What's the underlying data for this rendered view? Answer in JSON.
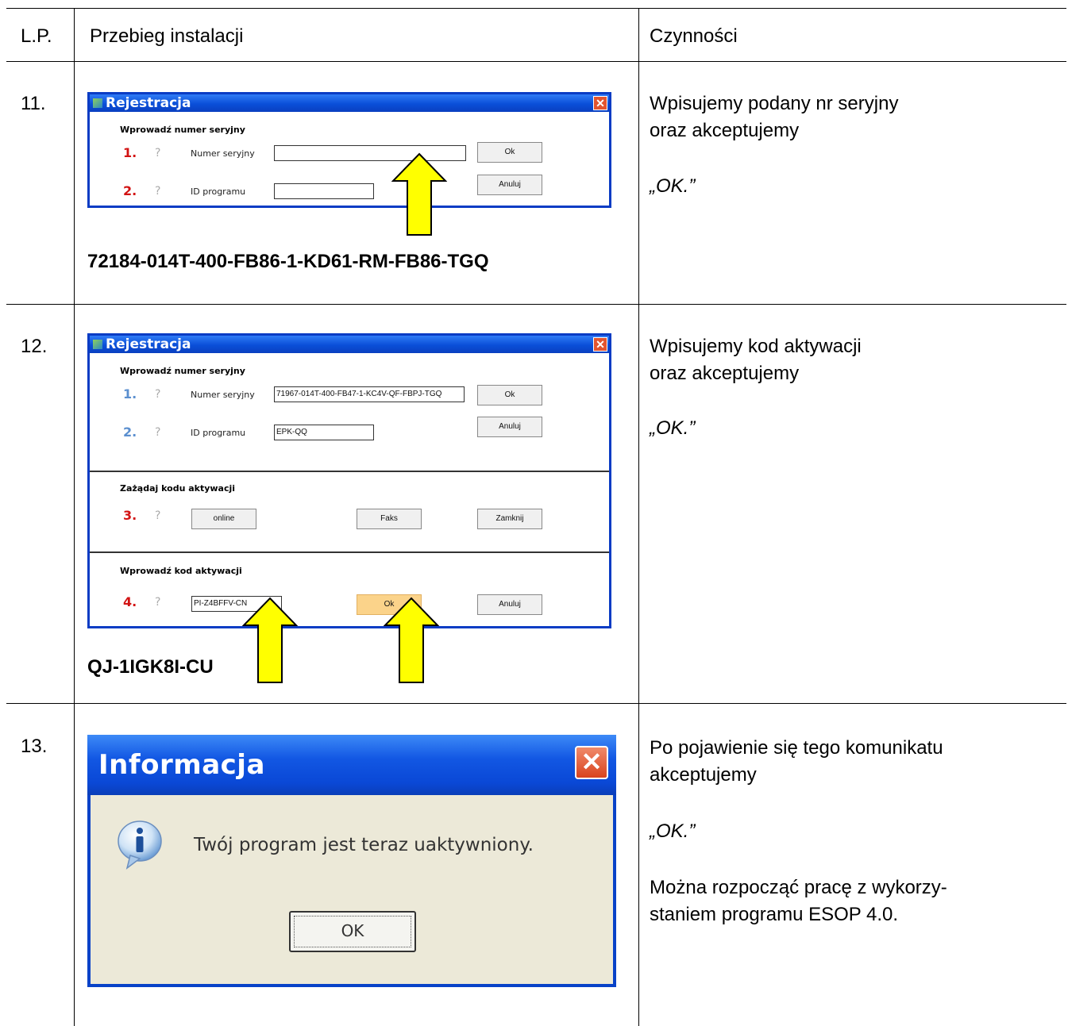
{
  "header": {
    "col_lp": "L.P.",
    "col_przebieg": "Przebieg instalacji",
    "col_czynnosci": "Czynności"
  },
  "rows": [
    {
      "lp": "11.",
      "serial_code": "72184-014T-400-FB86-1-KD61-RM-FB86-TGQ",
      "action_lines": [
        "Wpisujemy podany nr seryjny",
        "oraz akceptujemy"
      ],
      "action_ok": "„OK.”",
      "dialog": {
        "title": "Rejestracja",
        "section": "Wprowadź numer seryjny",
        "step1": "1.",
        "step2": "2.",
        "q": "?",
        "serial_label": "Numer seryjny",
        "id_label": "ID programu",
        "serial_value": "",
        "id_value": "",
        "ok": "Ok",
        "cancel": "Anuluj"
      }
    },
    {
      "lp": "12.",
      "activation_code": "QJ-1IGK8I-CU",
      "action_lines": [
        "Wpisujemy kod aktywacji",
        "oraz akceptujemy"
      ],
      "action_ok": "„OK.”",
      "dialog": {
        "title": "Rejestracja",
        "section1": "Wprowadź numer seryjny",
        "section2": "Zażądaj kodu aktywacji",
        "section3": "Wprowadź kod aktywacji",
        "step1": "1.",
        "step2": "2.",
        "step3": "3.",
        "step4": "4.",
        "q": "?",
        "serial_label": "Numer seryjny",
        "id_label": "ID programu",
        "serial_value": "71967-014T-400-FB47-1-KC4V-QF-FBPJ-TGQ",
        "id_value": "EPK-QQ",
        "activation_value": "PI-Z4BFFV-CN",
        "ok": "Ok",
        "cancel": "Anuluj",
        "online": "online",
        "fax": "Faks",
        "close": "Zamknij"
      }
    },
    {
      "lp": "13.",
      "action_lines": [
        "Po pojawienie się tego komunikatu",
        "akceptujemy"
      ],
      "action_ok": "„OK.”",
      "action_final": [
        "Można rozpocząć pracę z wykorzy-",
        "staniem programu ESOP 4.0."
      ],
      "dialog": {
        "title": "Informacja",
        "message": "Twój program jest teraz uaktywniony.",
        "ok": "OK"
      }
    }
  ],
  "colors": {
    "xp_title_blue": "#0a4fd8",
    "step_red": "#d21313",
    "arrow_yellow": "#ffff00",
    "dialog_bg": "#ece9d8"
  },
  "icons": [
    "close-icon",
    "app-icon",
    "info-icon",
    "arrow-up-icon"
  ]
}
